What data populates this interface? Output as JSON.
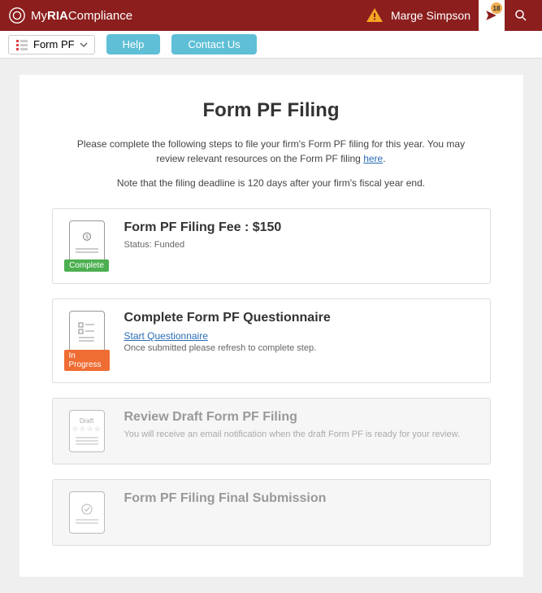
{
  "header": {
    "brand_prefix": "My",
    "brand_bold": "RIA",
    "brand_suffix": "Compliance",
    "user_name": "Marge Simpson",
    "notif_count": "18"
  },
  "toolbar": {
    "dropdown_label": "Form PF",
    "help": "Help",
    "contact": "Contact Us"
  },
  "main": {
    "title": "Form PF Filing",
    "intro_text_1": "Please complete the following steps to file your firm's Form PF filing for this year. You may review relevant resources on the Form PF filing ",
    "intro_link": "here",
    "intro_text_2": ".",
    "note": "Note that the filing deadline is 120 days after your firm's fiscal year end."
  },
  "steps": [
    {
      "title": "Form PF Filing Fee : $150",
      "status_text": "Status: Funded",
      "badge": "Complete"
    },
    {
      "title": "Complete Form PF Questionnaire",
      "link": "Start Questionnaire",
      "sub": "Once submitted please refresh to complete step.",
      "badge": "In Progress"
    },
    {
      "title": "Review Draft Form PF Filing",
      "sub": "You will receive an email notification when the draft Form PF is ready for your review.",
      "draft_label": "Draft"
    },
    {
      "title": "Form PF Filing Final Submission"
    }
  ]
}
